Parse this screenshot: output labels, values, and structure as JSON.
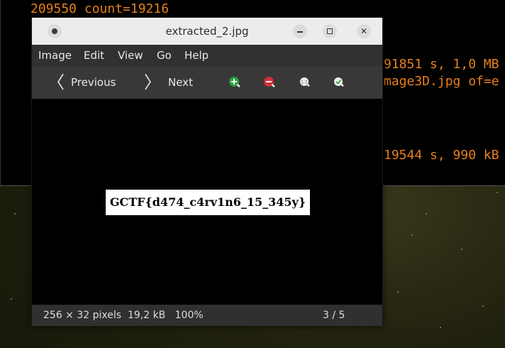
{
  "terminal": {
    "line1": "209550 count=19216",
    "line2": "91851 s, 1,0 MB",
    "line3": "mage3D.jpg of=e",
    "line4": "19544 s, 990 kB"
  },
  "window": {
    "title": "extracted_2.jpg"
  },
  "menu": {
    "image": "Image",
    "edit": "Edit",
    "view": "View",
    "go": "Go",
    "help": "Help"
  },
  "toolbar": {
    "previous_label": "Previous",
    "next_label": "Next",
    "icons": [
      "zoom-in-icon",
      "zoom-out-icon",
      "zoom-normal-icon",
      "zoom-fit-icon"
    ]
  },
  "image_content": {
    "flag_text": "GCTF{d474_c4rv1n6_15_345y}"
  },
  "status": {
    "info": "256 × 32 pixels  19,2 kB   100%",
    "position": "3 / 5"
  },
  "colors": {
    "terminal_text": "#e8801c",
    "zoom_in": "#2e9e3e",
    "zoom_out": "#d0303a"
  }
}
